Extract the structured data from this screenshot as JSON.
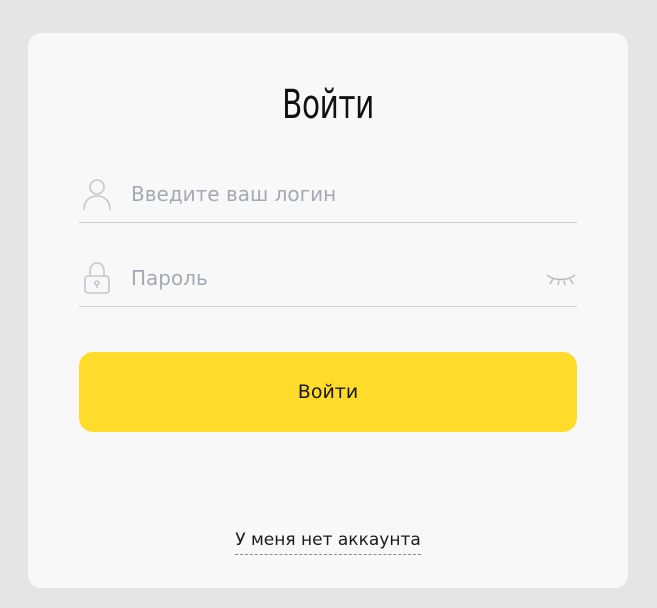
{
  "login_form": {
    "title": "Войти",
    "login_field": {
      "icon": "user-icon",
      "value": "",
      "placeholder": "Введите ваш логин"
    },
    "password_field": {
      "icon": "lock-icon",
      "value": "",
      "placeholder": "Пароль",
      "toggle_icon": "eye-closed-icon"
    },
    "submit_label": "Войти",
    "no_account_link": "У меня нет аккаунта"
  },
  "colors": {
    "background": "#e5e5e5",
    "card": "#f8f8f8",
    "accent": "#ffdb2b",
    "placeholder": "#a6a8b3",
    "divider": "#cfcfcf"
  }
}
